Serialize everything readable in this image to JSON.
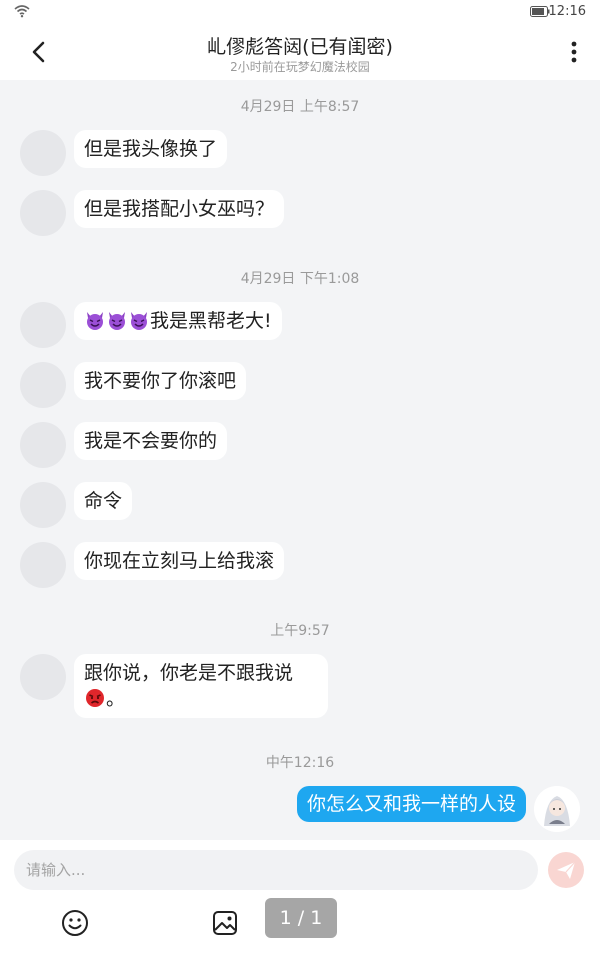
{
  "status_bar": {
    "time": "12:16"
  },
  "header": {
    "title": "乢僇彪答闼(已有闺密)",
    "subtitle": "2小时前在玩梦幻魔法校园",
    "back_icon": "chevron-left-icon",
    "more_icon": "vertical-dots-icon"
  },
  "messages": {
    "group1": {
      "timestamp": "4月29日 上午8:57",
      "m1": "但是我头像换了",
      "m2": "但是我搭配小女巫吗？"
    },
    "group2": {
      "timestamp": "4月29日 下午1:08",
      "m1_text": "我是黑帮老大!",
      "m1_emoji": "purple-devil-emoji",
      "m2": "我不要你了你滚吧",
      "m3": "我是不会要你的",
      "m4": "命令",
      "m5": "你现在立刻马上给我滚"
    },
    "group3": {
      "timestamp": "上午9:57",
      "m1_text": "跟你说，你老是不跟我说",
      "m1_suffix": "。",
      "m1_emoji": "angry-red-face-emoji"
    },
    "group4": {
      "timestamp": "中午12:16",
      "outgoing": "你怎么又和我一样的人设"
    }
  },
  "input_bar": {
    "placeholder": "请输入...",
    "send_icon": "send-paper-plane-icon",
    "emoji_icon": "smiley-icon",
    "image_icon": "image-icon"
  },
  "pager": {
    "label": "1 / 1"
  },
  "colors": {
    "outgoing_bubble": "#1ea7f0",
    "background": "#f3f4f6",
    "send_button": "#f9d6d2"
  }
}
